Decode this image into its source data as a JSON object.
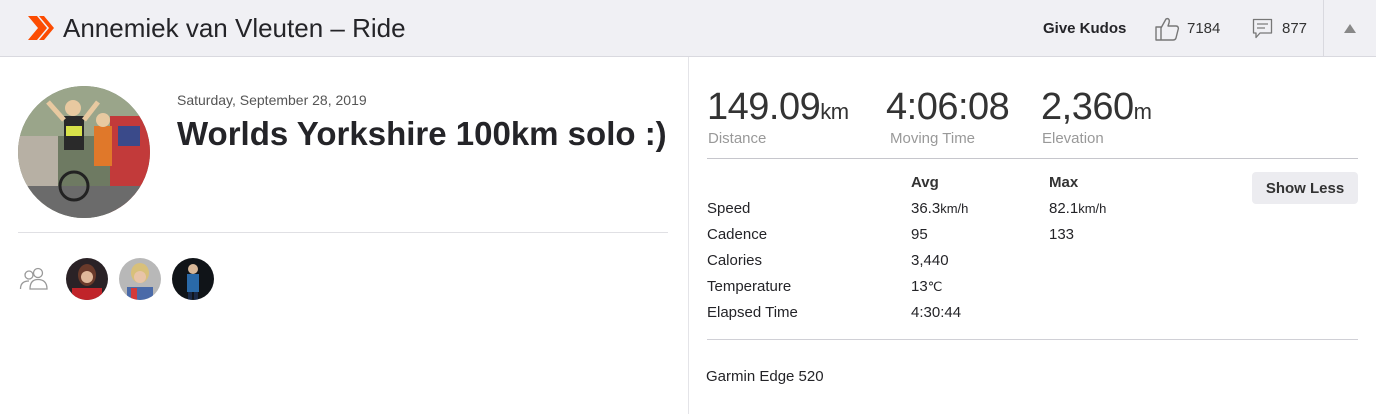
{
  "header": {
    "title": "Annemiek van Vleuten – Ride",
    "give_kudos_label": "Give Kudos",
    "kudos_count": "7184",
    "comment_count": "877",
    "brand_color": "#fc4c02"
  },
  "activity": {
    "date": "Saturday, September 28, 2019",
    "name": "Worlds Yorkshire 100km solo :)"
  },
  "stats": [
    {
      "value": "149.09",
      "unit": "km",
      "label": "Distance"
    },
    {
      "value": "4:06:08",
      "unit": "",
      "label": "Moving Time"
    },
    {
      "value": "2,360",
      "unit": "m",
      "label": "Elevation"
    }
  ],
  "details": {
    "avg_header": "Avg",
    "max_header": "Max",
    "show_less_label": "Show Less",
    "rows": [
      {
        "label": "Speed",
        "avg": "36.3",
        "avg_unit": "km/h",
        "max": "82.1",
        "max_unit": "km/h"
      },
      {
        "label": "Cadence",
        "avg": "95",
        "avg_unit": "",
        "max": "133",
        "max_unit": ""
      },
      {
        "label": "Calories",
        "avg": "3,440",
        "avg_unit": "",
        "max": "",
        "max_unit": ""
      },
      {
        "label": "Temperature",
        "avg": "13",
        "avg_unit": "℃",
        "max": "",
        "max_unit": ""
      },
      {
        "label": "Elapsed Time",
        "avg": "4:30:44",
        "avg_unit": "",
        "max": "",
        "max_unit": ""
      }
    ]
  },
  "device": "Garmin Edge 520",
  "icons": [
    "strava-logo-icon",
    "thumbs-up-icon",
    "comment-icon",
    "chevron-up-icon",
    "group-icon"
  ]
}
